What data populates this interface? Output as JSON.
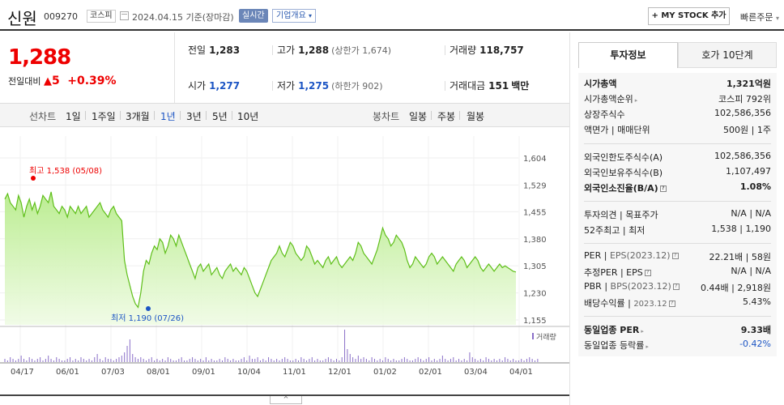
{
  "header": {
    "name": "신원",
    "code": "009270",
    "market": "코스피",
    "date": "2024.04.15 기준(장마감)",
    "realtime": "실시간",
    "overview": "기업개요",
    "my_stock": "+ MY STOCK 추가",
    "quick_order": "빠른주문"
  },
  "price": {
    "current": "1,288",
    "change_label": "전일대비",
    "change_arrow": "▲",
    "change_value": "5",
    "change_pct": "+0.39%"
  },
  "summary": {
    "prev_label": "전일",
    "prev": "1,283",
    "high_label": "고가",
    "high": "1,288",
    "upper": "(상한가 1,674)",
    "volume_label": "거래량",
    "volume": "118,757",
    "open_label": "시가",
    "open": "1,277",
    "low_label": "저가",
    "low": "1,275",
    "lower": "(하한가 902)",
    "amount_label": "거래대금",
    "amount": "151",
    "amount_unit": "백만"
  },
  "period_bar": {
    "line_label": "선차트",
    "items": [
      "1일",
      "1주일",
      "3개월",
      "1년",
      "3년",
      "5년",
      "10년"
    ],
    "selected": "1년",
    "candle_label": "봉차트",
    "candle_items": [
      "일봉",
      "주봉",
      "월봉"
    ]
  },
  "tabs": {
    "active": "투자정보",
    "inactive": "호가 10단계"
  },
  "invest": {
    "mcap_label": "시가총액",
    "mcap": "1,321억원",
    "rank_label": "시가총액순위",
    "rank": "코스피 792위",
    "shares_label": "상장주식수",
    "shares": "102,586,356",
    "par_label": "액면가",
    "lot_label": "매매단위",
    "par": "500원",
    "lot": "1주",
    "foreign_limit_label": "외국인한도주식수(A)",
    "foreign_limit": "102,586,356",
    "foreign_hold_label": "외국인보유주식수(B)",
    "foreign_hold": "1,107,497",
    "foreign_ratio_label": "외국인소진율(B/A)",
    "foreign_ratio": "1.08%",
    "opinion_label": "투자의견",
    "target_label": "목표주가",
    "opinion": "N/A",
    "target": "N/A",
    "wk52_label": "52주최고",
    "wk52_low_label": "최저",
    "wk52_high": "1,538",
    "wk52_low": "1,190",
    "per_label": "PER",
    "eps_label": "EPS(2023.12)",
    "per": "22.21배",
    "eps": "58원",
    "eper_label": "추정PER",
    "eeps_label": "EPS",
    "eper": "N/A",
    "eeps": "N/A",
    "pbr_label": "PBR",
    "bps_label": "BPS(2023.12)",
    "pbr": "0.44배",
    "bps": "2,918원",
    "div_label": "배당수익률",
    "div_date": "2023.12",
    "div": "5.43%",
    "ind_per_label": "동일업종 PER",
    "ind_per": "9.33배",
    "ind_rate_label": "동일업종 등락률",
    "ind_rate": "-0.42%"
  },
  "chart_data": {
    "type": "area",
    "y_ticks": [
      1604,
      1529,
      1455,
      1380,
      1305,
      1230,
      1155
    ],
    "ylim": [
      1155,
      1604
    ],
    "x_labels": [
      "04/17",
      "06/01",
      "07/03",
      "08/01",
      "09/01",
      "10/04",
      "11/01",
      "12/01",
      "01/02",
      "02/01",
      "03/04",
      "04/01"
    ],
    "high_annotation": "최고 1,538 (05/08)",
    "low_annotation": "최저 1,190 (07/26)",
    "volume_label": "거래량",
    "close": [
      1490,
      1505,
      1480,
      1470,
      1460,
      1500,
      1480,
      1440,
      1470,
      1490,
      1460,
      1480,
      1450,
      1470,
      1500,
      1490,
      1480,
      1510,
      1470,
      1460,
      1450,
      1470,
      1460,
      1440,
      1470,
      1460,
      1450,
      1470,
      1450,
      1460,
      1470,
      1440,
      1450,
      1460,
      1470,
      1480,
      1460,
      1450,
      1440,
      1460,
      1470,
      1450,
      1440,
      1430,
      1320,
      1280,
      1250,
      1220,
      1200,
      1190,
      1230,
      1290,
      1320,
      1310,
      1340,
      1360,
      1350,
      1380,
      1370,
      1340,
      1360,
      1390,
      1380,
      1360,
      1390,
      1370,
      1350,
      1330,
      1310,
      1290,
      1270,
      1300,
      1310,
      1290,
      1300,
      1310,
      1280,
      1290,
      1300,
      1280,
      1270,
      1290,
      1300,
      1310,
      1290,
      1300,
      1290,
      1280,
      1300,
      1290,
      1270,
      1250,
      1230,
      1220,
      1240,
      1260,
      1280,
      1300,
      1320,
      1330,
      1340,
      1360,
      1340,
      1330,
      1350,
      1370,
      1360,
      1340,
      1330,
      1320,
      1330,
      1360,
      1350,
      1330,
      1310,
      1320,
      1310,
      1300,
      1320,
      1330,
      1310,
      1320,
      1330,
      1310,
      1300,
      1310,
      1320,
      1330,
      1320,
      1340,
      1370,
      1360,
      1340,
      1330,
      1320,
      1310,
      1330,
      1350,
      1380,
      1410,
      1390,
      1380,
      1360,
      1370,
      1390,
      1380,
      1370,
      1350,
      1320,
      1300,
      1310,
      1330,
      1320,
      1310,
      1300,
      1310,
      1330,
      1340,
      1330,
      1310,
      1320,
      1330,
      1320,
      1310,
      1300,
      1290,
      1310,
      1320,
      1330,
      1320,
      1300,
      1310,
      1320,
      1330,
      1320,
      1300,
      1290,
      1300,
      1310,
      1300,
      1290,
      1300,
      1310,
      1300,
      1305,
      1300,
      1295,
      1290,
      1288
    ],
    "volume": [
      2,
      1,
      3,
      2,
      1,
      2,
      4,
      2,
      1,
      3,
      2,
      1,
      2,
      3,
      1,
      2,
      4,
      2,
      1,
      3,
      2,
      1,
      1,
      2,
      3,
      1,
      2,
      1,
      3,
      2,
      1,
      2,
      1,
      3,
      5,
      2,
      1,
      3,
      2,
      2,
      1,
      2,
      3,
      4,
      6,
      10,
      14,
      5,
      3,
      2,
      3,
      2,
      1,
      2,
      3,
      1,
      2,
      1,
      2,
      1,
      3,
      2,
      1,
      1,
      2,
      3,
      1,
      1,
      2,
      3,
      2,
      1,
      2,
      1,
      3,
      1,
      2,
      1,
      1,
      2,
      1,
      3,
      2,
      1,
      2,
      1,
      1,
      2,
      3,
      1,
      4,
      2,
      2,
      3,
      1,
      2,
      1,
      3,
      2,
      1,
      2,
      1,
      2,
      3,
      2,
      1,
      1,
      2,
      1,
      3,
      2,
      1,
      2,
      3,
      1,
      2,
      1,
      1,
      2,
      3,
      2,
      1,
      2,
      1,
      3,
      20,
      8,
      5,
      3,
      2,
      4,
      2,
      3,
      2,
      1,
      3,
      2,
      1,
      2,
      1,
      3,
      2,
      1,
      2,
      1,
      1,
      2,
      3,
      2,
      1,
      1,
      2,
      3,
      2,
      1,
      2,
      3,
      1,
      2,
      1,
      2,
      4,
      2,
      1,
      2,
      3,
      1,
      2,
      1,
      2,
      1,
      6,
      3,
      2,
      1,
      2,
      1,
      3,
      2,
      1,
      2,
      1,
      2,
      1,
      3,
      2,
      1,
      2,
      1,
      1,
      2,
      1,
      2,
      3,
      2,
      1,
      2
    ]
  }
}
